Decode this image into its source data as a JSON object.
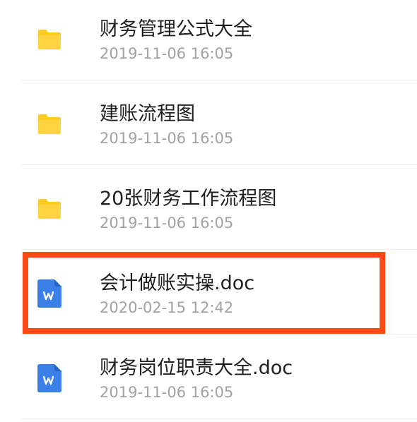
{
  "files": [
    {
      "name": "财务管理公式大全",
      "date": "2019-11-06 16:05",
      "icon": "folder-icon"
    },
    {
      "name": "建账流程图",
      "date": "2019-11-06 16:05",
      "icon": "folder-icon"
    },
    {
      "name": "20张财务工作流程图",
      "date": "2019-11-06 16:05",
      "icon": "folder-icon"
    },
    {
      "name": "会计做账实操.doc",
      "date": "2020-02-15 12:42",
      "icon": "word-doc-icon"
    },
    {
      "name": "财务岗位职责大全.doc",
      "date": "2019-11-06 16:05",
      "icon": "word-doc-icon"
    }
  ],
  "colors": {
    "folder": "#ffc928",
    "word_doc": "#3b7fe9",
    "highlight": "#ff4a17",
    "divider": "#ececec"
  }
}
